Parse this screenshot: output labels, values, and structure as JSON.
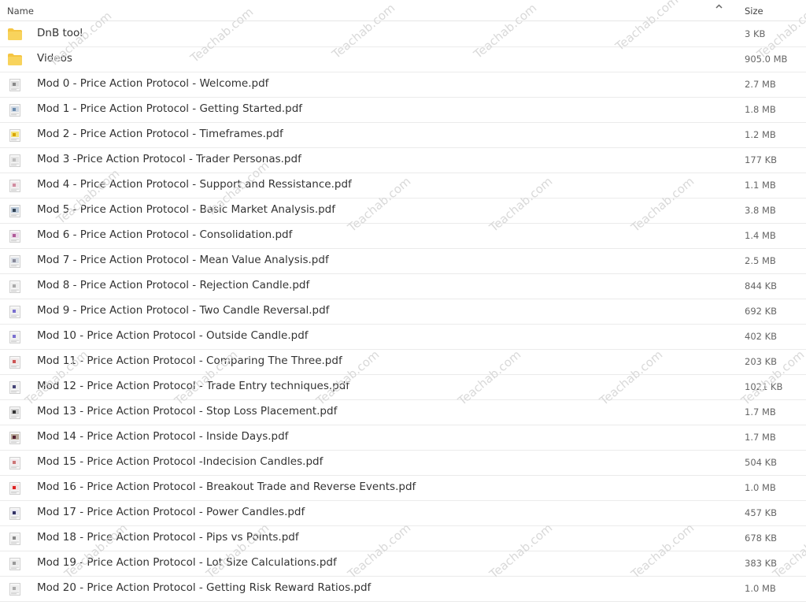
{
  "header": {
    "name_label": "Name",
    "size_label": "Size",
    "sort_icon": "chevron-up-icon"
  },
  "rows": [
    {
      "name": "DnB tool",
      "size": "3 KB",
      "type": "folder"
    },
    {
      "name": "Videos",
      "size": "905.0 MB",
      "type": "folder"
    },
    {
      "name": "Mod 0 - Price Action Protocol - Welcome.pdf",
      "size": "2.7 MB",
      "type": "pdf"
    },
    {
      "name": "Mod 1 - Price Action Protocol - Getting Started.pdf",
      "size": "1.8 MB",
      "type": "pdf"
    },
    {
      "name": "Mod 2 - Price Action Protocol - Timeframes.pdf",
      "size": "1.2 MB",
      "type": "pdf"
    },
    {
      "name": "Mod 3 -Price Action Protocol - Trader Personas.pdf",
      "size": "177 KB",
      "type": "pdf"
    },
    {
      "name": "Mod 4 - Price Action Protocol - Support and Ressistance.pdf",
      "size": "1.1 MB",
      "type": "pdf"
    },
    {
      "name": "Mod 5 - Price Action Protocol - Basic Market Analysis.pdf",
      "size": "3.8 MB",
      "type": "pdf"
    },
    {
      "name": "Mod 6 - Price Action Protocol - Consolidation.pdf",
      "size": "1.4 MB",
      "type": "pdf"
    },
    {
      "name": "Mod 7 - Price Action Protocol - Mean Value Analysis.pdf",
      "size": "2.5 MB",
      "type": "pdf"
    },
    {
      "name": "Mod 8 - Price Action Protocol - Rejection Candle.pdf",
      "size": "844 KB",
      "type": "pdf"
    },
    {
      "name": "Mod 9 - Price Action Protocol - Two Candle Reversal.pdf",
      "size": "692 KB",
      "type": "pdf"
    },
    {
      "name": "Mod 10 - Price Action Protocol - Outside Candle.pdf",
      "size": "402 KB",
      "type": "pdf"
    },
    {
      "name": "Mod 11 - Price Action Protocol - Comparing The Three.pdf",
      "size": "203 KB",
      "type": "pdf"
    },
    {
      "name": "Mod 12 - Price Action Protocol - Trade Entry techniques.pdf",
      "size": "1021 KB",
      "type": "pdf"
    },
    {
      "name": "Mod 13 - Price Action Protocol - Stop Loss Placement.pdf",
      "size": "1.7 MB",
      "type": "pdf"
    },
    {
      "name": "Mod 14 - Price Action Protocol - Inside Days.pdf",
      "size": "1.7 MB",
      "type": "pdf"
    },
    {
      "name": "Mod 15 - Price Action Protocol -Indecision Candles.pdf",
      "size": "504 KB",
      "type": "pdf"
    },
    {
      "name": "Mod 16 - Price Action Protocol - Breakout Trade and Reverse Events.pdf",
      "size": "1.0 MB",
      "type": "pdf"
    },
    {
      "name": "Mod 17 - Price Action Protocol - Power Candles.pdf",
      "size": "457 KB",
      "type": "pdf"
    },
    {
      "name": "Mod 18 - Price Action Protocol - Pips vs Points.pdf",
      "size": "678 KB",
      "type": "pdf"
    },
    {
      "name": "Mod 19 - Price Action Protocol - Lot Size Calculations.pdf",
      "size": "383 KB",
      "type": "pdf"
    },
    {
      "name": "Mod 20 - Price Action Protocol - Getting Risk Reward Ratios.pdf",
      "size": "1.0 MB",
      "type": "pdf"
    }
  ],
  "watermark_text": "Teachab.com",
  "colors": {
    "folder": "#f5c542",
    "row_border": "#ebebeb",
    "watermark": "#d9d9d9"
  }
}
